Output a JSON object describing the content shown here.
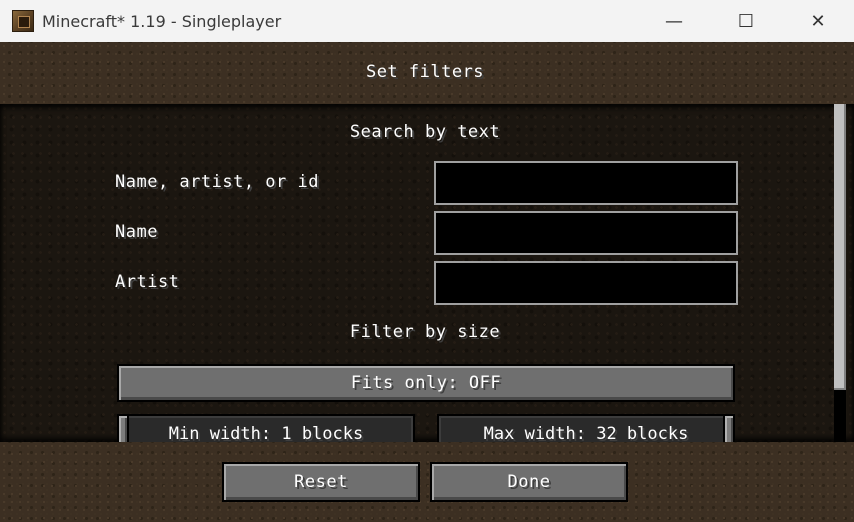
{
  "window": {
    "title": "Minecraft* 1.19 - Singleplayer",
    "minimize_icon": "minimize-icon",
    "maximize_icon": "maximize-icon",
    "close_icon": "close-icon",
    "minimize_glyph": "—",
    "maximize_glyph": "☐",
    "close_glyph": "✕"
  },
  "screen": {
    "title": "Set filters"
  },
  "search": {
    "heading": "Search by text",
    "fields": [
      {
        "label": "Name, artist, or id",
        "value": ""
      },
      {
        "label": "Name",
        "value": ""
      },
      {
        "label": "Artist",
        "value": ""
      }
    ]
  },
  "size_filter": {
    "heading": "Filter by size",
    "fits_only": "Fits only: OFF",
    "min_width": "Min width: 1 blocks",
    "max_width": "Max width: 32 blocks"
  },
  "footer": {
    "reset": "Reset",
    "done": "Done"
  }
}
